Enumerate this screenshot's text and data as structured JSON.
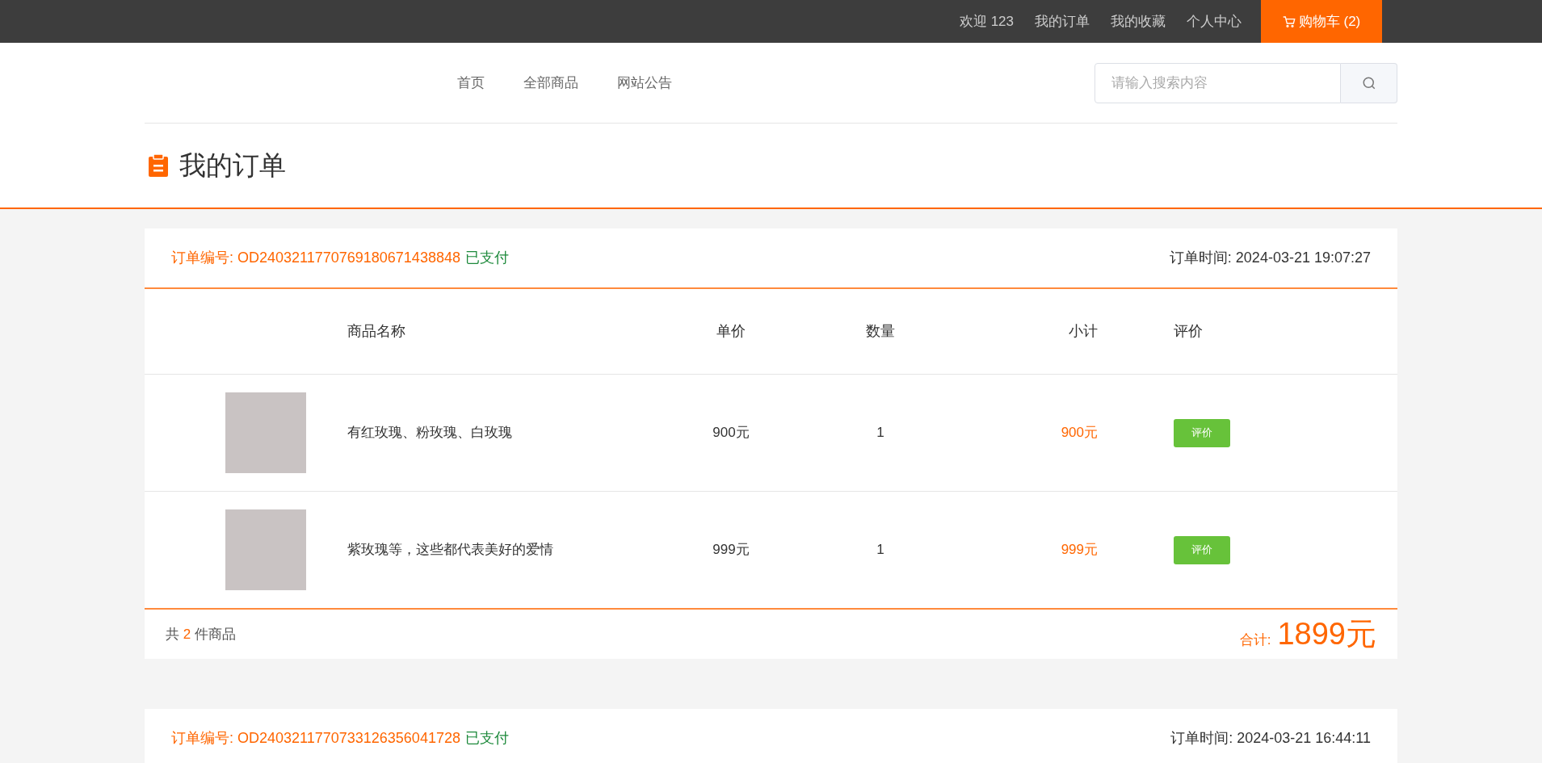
{
  "top_bar": {
    "links": [
      "欢迎 123",
      "我的订单",
      "我的收藏",
      "个人中心"
    ],
    "cart": "购物车 (2)"
  },
  "nav": {
    "items": [
      "首页",
      "全部商品",
      "网站公告"
    ],
    "search": {
      "placeholder": "请输入搜索内容"
    }
  },
  "page_title": "我的订单",
  "orders": [
    {
      "number": "订单编号: OD2403211770769180671438848",
      "status": "已支付",
      "time": "订单时间: 2024-03-21 19:07:27",
      "columns": [
        "商品名称",
        "单价",
        "数量",
        "小计",
        "评价"
      ],
      "rows": [
        {
          "name": "有红玫瑰、粉玫瑰、白玫瑰",
          "price": "900元",
          "quantity": "1",
          "subtotal": "900元",
          "action": "评价"
        },
        {
          "name": "紫玫瑰等，这些都代表美好的爱情",
          "price": "999元",
          "quantity": "1",
          "subtotal": "999元",
          "action": "评价"
        }
      ],
      "footer": {
        "prefix": "共",
        "count": "2",
        "suffix": "件商品",
        "total_label": "合计:",
        "total": "1899元"
      }
    },
    {
      "number": "订单编号: OD2403211770733126356041728",
      "status": "已支付",
      "time": "订单时间: 2024-03-21 16:44:11"
    }
  ]
}
